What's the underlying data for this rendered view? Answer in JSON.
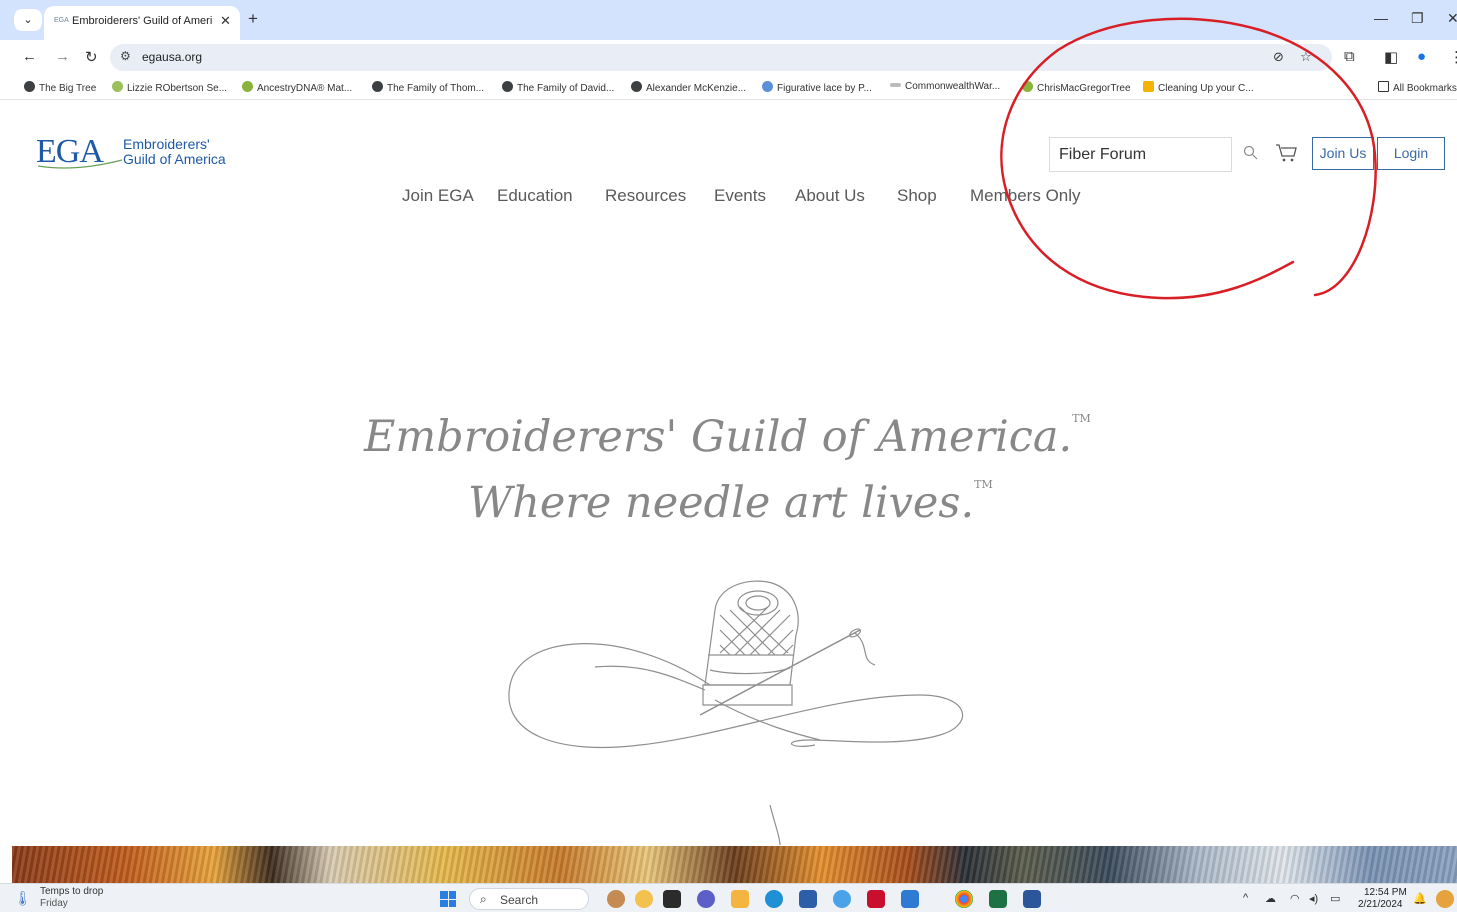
{
  "browser": {
    "tab_title": "Embroiderers' Guild of America",
    "tab_favicon_text": "EGA",
    "url": "egausa.org",
    "new_tab_label": "+",
    "bookmarks": [
      "The Big Tree",
      "Lizzie RObertson Se...",
      "AncestryDNA® Mat...",
      "The Family of Thom...",
      "The Family of David...",
      "Alexander McKenzie...",
      "Figurative lace by P...",
      "CommonwealthWar...",
      "ChrisMacGregorTree",
      "Cleaning Up your C..."
    ],
    "all_bookmarks": "All Bookmarks"
  },
  "site": {
    "logo_mark": "EGA",
    "logo_name_line1": "Embroiderers'",
    "logo_name_line2": "Guild of America",
    "search_value": "Fiber Forum",
    "join_label": "Join Us",
    "login_label": "Login",
    "nav": [
      "Join EGA",
      "Education",
      "Resources",
      "Events",
      "About Us",
      "Shop",
      "Members Only"
    ],
    "hero_line1": "Embroiderers' Guild of America.",
    "hero_line2": "Where needle art lives.",
    "tm": "TM"
  },
  "taskbar": {
    "weather_line1": "Temps to drop",
    "weather_line2": "Friday",
    "search_label": "Search",
    "time": "12:54 PM",
    "date": "2/21/2024"
  },
  "colors": {
    "brand_blue": "#1f5aa6",
    "annotation_red": "#d81f26",
    "tab_strip": "#d3e3fd"
  }
}
